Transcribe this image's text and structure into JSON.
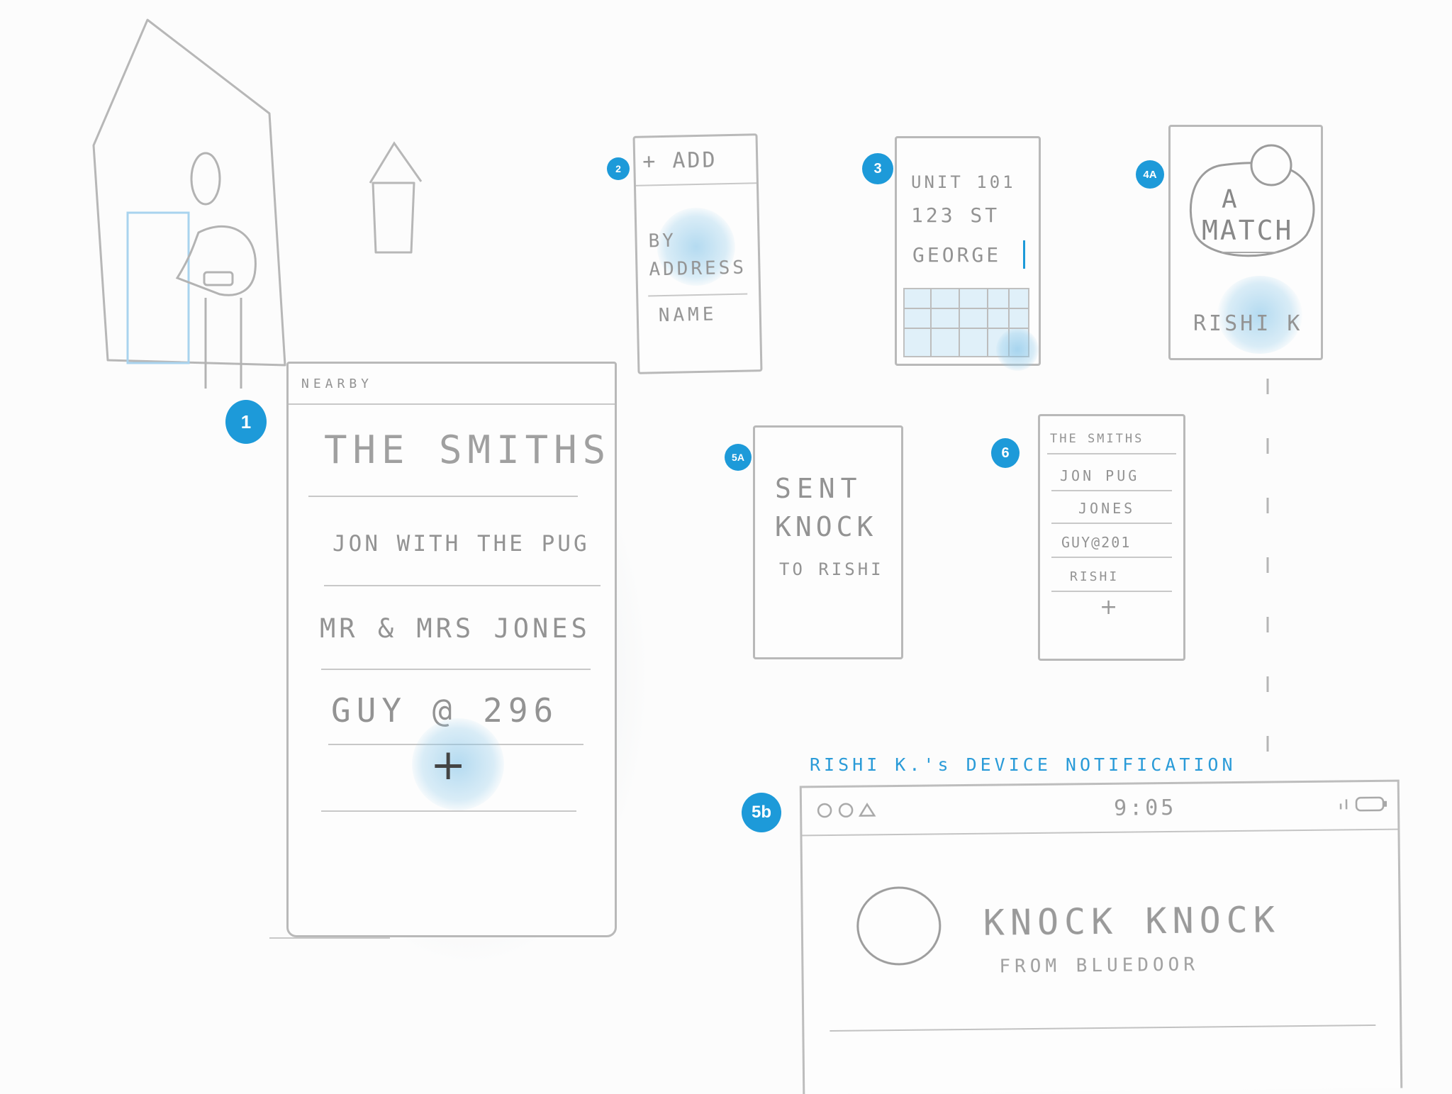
{
  "badges": {
    "s1": "1",
    "s2": "2",
    "s3": "3",
    "s4a": "4A",
    "s5a": "5A",
    "s6": "6",
    "s5b": "5b"
  },
  "screen1": {
    "header": "NEARBY",
    "items": [
      "THE SMITHS",
      "JON WITH THE PUG",
      "MR & MRS JONES",
      "GUY @ 296"
    ],
    "add_symbol": "+"
  },
  "screen2": {
    "header": "+ ADD",
    "options": [
      "BY ADDRESS",
      "NAME"
    ]
  },
  "screen3": {
    "lines": [
      "UNIT 101",
      "123 ST",
      "GEORGE"
    ]
  },
  "screen4a": {
    "title_line1": "A",
    "title_line2": "MATCH",
    "name": "RISHI K"
  },
  "screen5a": {
    "lines": [
      "SENT",
      "KNOCK",
      "TO RISHI"
    ]
  },
  "screen6": {
    "items": [
      "THE SMITHS",
      "JON PUG",
      "JONES",
      "GUY@201",
      "RISHI"
    ],
    "add_symbol": "+"
  },
  "notification": {
    "caption": "RISHI K.'s DEVICE NOTIFICATION",
    "status_time": "9:05",
    "title": "KNOCK KNOCK",
    "subtitle": "FROM BLUEDOOR"
  },
  "colors": {
    "accent": "#1d9ad9",
    "pencil": "#b9b9b9"
  }
}
